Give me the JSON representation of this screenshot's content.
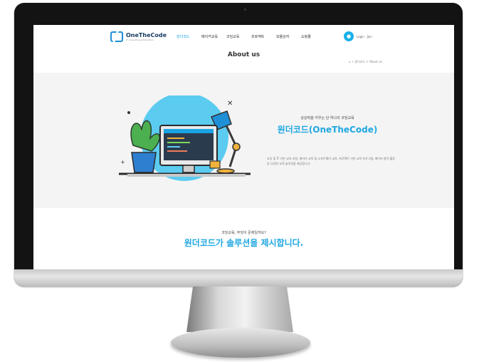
{
  "header": {
    "logo_name": "OneTheCode",
    "logo_sub": "IT Consulting & Education",
    "nav": [
      "원더코드",
      "메이커교육",
      "코딩교육",
      "프로젝트",
      "보물상자",
      "쇼핑몰"
    ],
    "user_links": "Login  ·  Join"
  },
  "page": {
    "title": "About us",
    "breadcrumb": "⌂  >  원더코드  >  About us"
  },
  "hero": {
    "subtitle": "상상력을 키우는 단 하나의 코딩교육",
    "title": "원더코드(OneTheCode)",
    "description": "코딩 및 IT 기반 교육 과정, 메이커 교육 및 소프트웨어 교육, 프로젝트 기반 교육 프로그램, 메이커 창작 활동 등 다양한 교육 솔루션을 제공합니다."
  },
  "section2": {
    "subtitle": "코딩교육, 무엇이 문제일까요?",
    "title": "원더코드가 솔루션을 제시합니다."
  },
  "colors": {
    "accent": "#1fa7e1",
    "hero_bg": "#f4f4f4",
    "bezel": "#131313"
  }
}
